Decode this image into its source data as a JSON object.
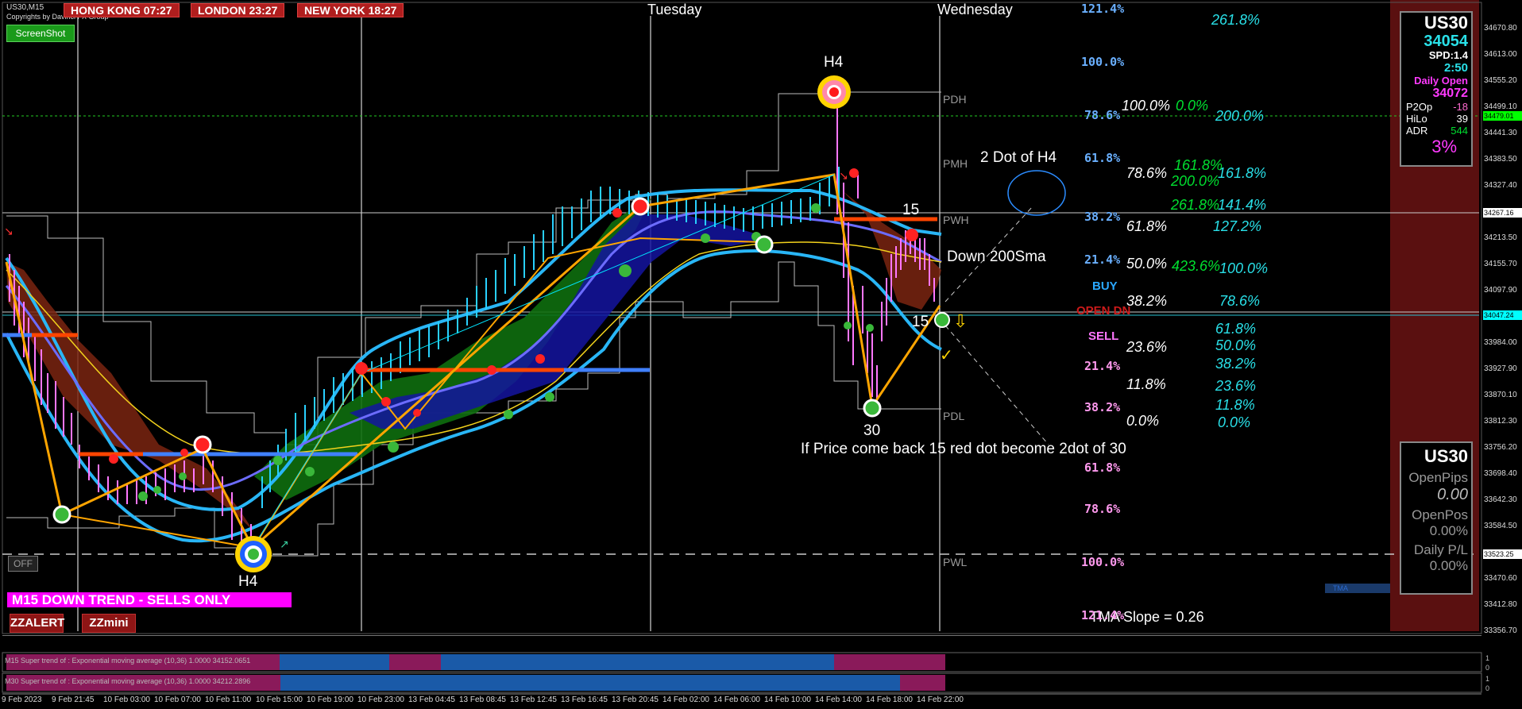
{
  "symbol_tf": "US30,M15",
  "copyright": "Copyrights by Davinci FX Group",
  "clocks": [
    "HONG KONG  07:27",
    "LONDON  23:27",
    "NEW YORK  18:27"
  ],
  "screenshot_button": "ScreenShot",
  "days": [
    "Tuesday",
    "Wednesday"
  ],
  "levels": [
    "PDH",
    "PMH",
    "PWH",
    "PDL",
    "PWL"
  ],
  "annotations": {
    "h4_top": "H4",
    "h4_bottom": "H4",
    "dot_of_h4": "2 Dot of H4",
    "down_200sma": "Down 200Sma",
    "fifteen_a": "15",
    "fifteen_b": "15",
    "thirty": "30",
    "if_price": "If Price come back 15 red dot become 2dot of 30",
    "tma_slope": "TMA Slope = 0.26"
  },
  "signals": {
    "buy": "BUY",
    "open_dn": "OPEN DN",
    "sell": "SELL"
  },
  "fib_blue": [
    "121.4%",
    "100.0%",
    "78.6%",
    "61.8%",
    "38.2%",
    "21.4%"
  ],
  "fib_pink": [
    "21.4%",
    "38.2%",
    "61.8%",
    "78.6%",
    "100.0%",
    "121.4%"
  ],
  "fib_white": [
    "100.0%",
    "78.6%",
    "61.8%",
    "50.0%",
    "38.2%",
    "23.6%",
    "11.8%",
    "0.0%"
  ],
  "fib_cyan": [
    "261.8%",
    "200.0%",
    "161.8%",
    "141.4%",
    "127.2%",
    "100.0%",
    "78.6%",
    "61.8%",
    "50.0%",
    "38.2%",
    "23.6%",
    "11.8%",
    "0.0%"
  ],
  "fib_green": [
    "0.0%",
    "161.8%",
    "200.0%",
    "261.8%",
    "423.6%"
  ],
  "trend_text": "M15  DOWN TREND - SELLS ONLY",
  "off_button": "OFF",
  "zzalert_button": "ZZALERT",
  "zzmini_button": "ZZmini",
  "tma_tag": "TMA",
  "panel1": {
    "symbol": "US30",
    "price": "34054",
    "spd": "SPD:1.4",
    "timer": "2:50",
    "daily_open_label": "Daily Open",
    "daily_open": "34072",
    "rows": [
      {
        "label": "P2Op",
        "value": "-18"
      },
      {
        "label": "HiLo",
        "value": "39"
      },
      {
        "label": "ADR",
        "value": "544"
      }
    ],
    "pct": "3%"
  },
  "panel2": {
    "symbol": "US30",
    "open_pips_label": "OpenPips",
    "open_pips": "0.00",
    "open_pos_label": "OpenPos",
    "open_pos": "0.00%",
    "daily_pl_label": "Daily P/L",
    "daily_pl": "0.00%"
  },
  "price_ticks": [
    "34670.80",
    "34613.00",
    "34555.20",
    "34499.10",
    "34441.30",
    "34383.50",
    "34327.40",
    "34213.50",
    "34155.70",
    "34097.90",
    "33984.00",
    "33927.90",
    "33870.10",
    "33812.30",
    "33756.20",
    "33698.40",
    "33642.30",
    "33584.50",
    "33470.60",
    "33412.80",
    "33356.70"
  ],
  "price_labels": [
    {
      "text": "34479.01",
      "color": "#00ff00"
    },
    {
      "text": "34267.16",
      "color": "#ffffff"
    },
    {
      "text": "34047.24",
      "color": "#00ffff"
    },
    {
      "text": "33523.25",
      "color": "#ffffff"
    }
  ],
  "subwindows": [
    "M15  Super trend of : Exponential moving average (10,36)  1.0000  34152.0651",
    "M30  Super trend of : Exponential moving average (10,36)  1.0000  34212.2896"
  ],
  "sub_scale": [
    "1",
    "0",
    "1",
    "0"
  ],
  "time_labels": [
    "9 Feb 2023",
    "9 Feb 21:45",
    "10 Feb 03:00",
    "10 Feb 07:00",
    "10 Feb 11:00",
    "10 Feb 15:00",
    "10 Feb 19:00",
    "10 Feb 23:00",
    "13 Feb 04:45",
    "13 Feb 08:45",
    "13 Feb 12:45",
    "13 Feb 16:45",
    "13 Feb 20:45",
    "14 Feb 02:00",
    "14 Feb 06:00",
    "14 Feb 10:00",
    "14 Feb 14:00",
    "14 Feb 18:00",
    "14 Feb 22:00"
  ],
  "colors": {
    "bull": "#1a8a1a",
    "bear": "#8a2a10",
    "band": "#29b6f6",
    "zigzag": "#ffa500",
    "accent_pink": "#ff00ff"
  }
}
